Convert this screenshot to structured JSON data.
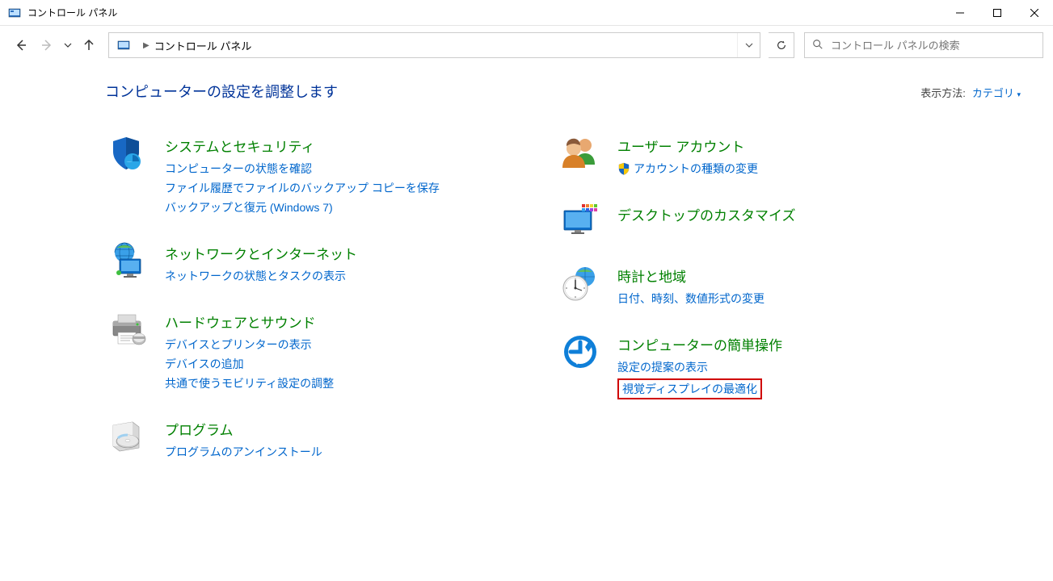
{
  "window": {
    "title": "コントロール パネル"
  },
  "nav": {
    "breadcrumb": "コントロール パネル",
    "search_placeholder": "コントロール パネルの検索"
  },
  "header": {
    "heading": "コンピューターの設定を調整します",
    "view_by_label": "表示方法:",
    "view_by_value": "カテゴリ"
  },
  "left_column": [
    {
      "id": "system-security",
      "title": "システムとセキュリティ",
      "links": [
        "コンピューターの状態を確認",
        "ファイル履歴でファイルのバックアップ コピーを保存",
        "バックアップと復元 (Windows 7)"
      ]
    },
    {
      "id": "network-internet",
      "title": "ネットワークとインターネット",
      "links": [
        "ネットワークの状態とタスクの表示"
      ]
    },
    {
      "id": "hardware-sound",
      "title": "ハードウェアとサウンド",
      "links": [
        "デバイスとプリンターの表示",
        "デバイスの追加",
        "共通で使うモビリティ設定の調整"
      ]
    },
    {
      "id": "programs",
      "title": "プログラム",
      "links": [
        "プログラムのアンインストール"
      ]
    }
  ],
  "right_column": [
    {
      "id": "user-accounts",
      "title": "ユーザー アカウント",
      "links": [
        {
          "text": "アカウントの種類の変更",
          "shield": true
        }
      ]
    },
    {
      "id": "appearance",
      "title": "デスクトップのカスタマイズ",
      "links": []
    },
    {
      "id": "clock-region",
      "title": "時計と地域",
      "links": [
        "日付、時刻、数値形式の変更"
      ]
    },
    {
      "id": "ease-of-access",
      "title": "コンピューターの簡単操作",
      "links": [
        "設定の提案の表示",
        {
          "text": "視覚ディスプレイの最適化",
          "highlighted": true
        }
      ]
    }
  ]
}
